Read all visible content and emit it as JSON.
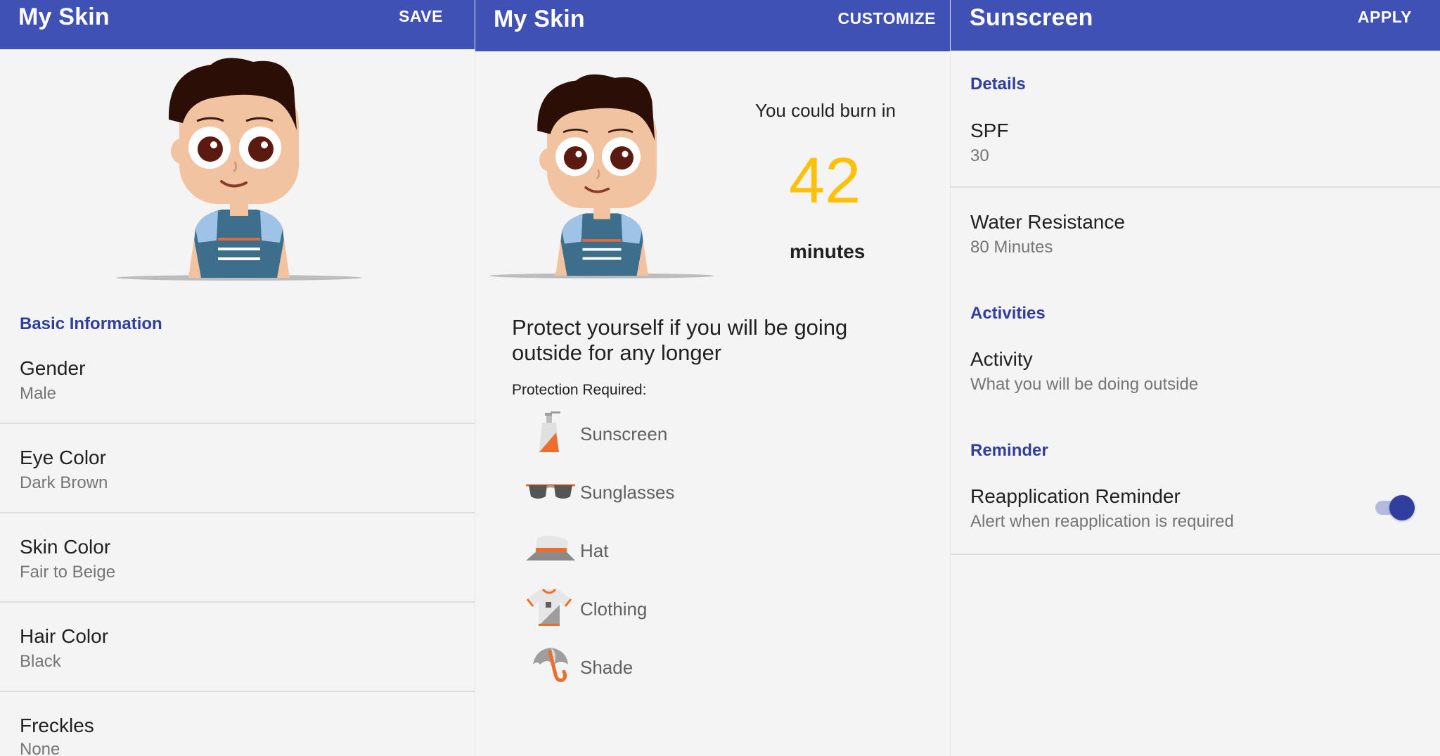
{
  "colors": {
    "appbar": "#3f51b5",
    "section_header": "#303f9f",
    "burn_number": "#ffc107",
    "background": "#f4f4f4"
  },
  "my_skin": {
    "title": "My Skin",
    "action": "SAVE",
    "section": "Basic Information",
    "items": [
      {
        "label": "Gender",
        "value": "Male"
      },
      {
        "label": "Eye Color",
        "value": "Dark Brown"
      },
      {
        "label": "Skin Color",
        "value": "Fair to Beige"
      },
      {
        "label": "Hair Color",
        "value": "Black"
      },
      {
        "label": "Freckles",
        "value": "None"
      }
    ]
  },
  "burn": {
    "title": "My Skin",
    "action": "CUSTOMIZE",
    "burn_intro": "You could burn in",
    "burn_minutes": "42",
    "burn_unit": "minutes",
    "protect_line1": "Protect yourself if you will be going",
    "protect_line2": "outside for any longer",
    "protection_label": "Protection Required:",
    "protection": [
      {
        "label": "Sunscreen",
        "icon": "sunscreen-icon"
      },
      {
        "label": "Sunglasses",
        "icon": "sunglasses-icon"
      },
      {
        "label": "Hat",
        "icon": "hat-icon"
      },
      {
        "label": "Clothing",
        "icon": "clothing-icon"
      },
      {
        "label": "Shade",
        "icon": "umbrella-icon"
      }
    ]
  },
  "sunscreen": {
    "title": "Sunscreen",
    "action": "APPLY",
    "details_header": "Details",
    "spf_label": "SPF",
    "spf_value": "30",
    "water_label": "Water Resistance",
    "water_value": "80 Minutes",
    "activities_header": "Activities",
    "activity_label": "Activity",
    "activity_value": "What you will be doing outside",
    "reminder_header": "Reminder",
    "reminder_label": "Reapplication Reminder",
    "reminder_value": "Alert when reapplication is required",
    "reminder_on": true
  }
}
